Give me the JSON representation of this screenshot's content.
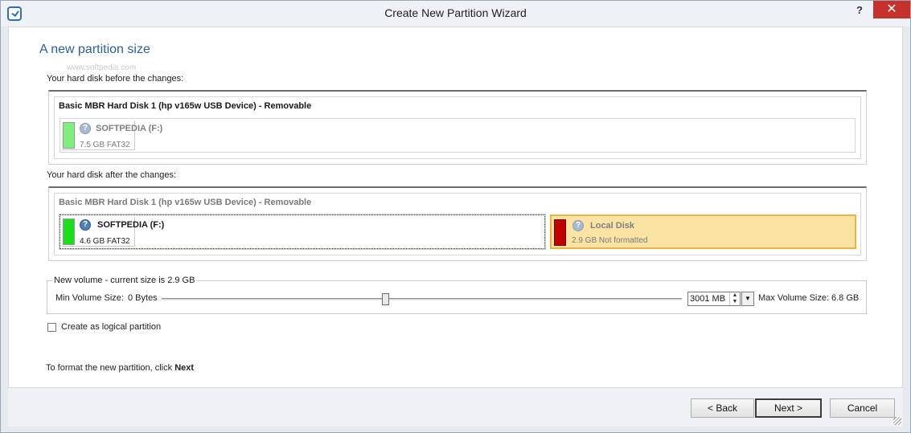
{
  "window": {
    "title": "Create New Partition Wizard",
    "help": "?",
    "close": "✕"
  },
  "page": {
    "heading": "A new partition size",
    "watermark": "www.softpedia.com",
    "before_label": "Your hard disk before the changes:",
    "after_label": "Your hard disk after the changes:"
  },
  "before": {
    "disk_title": "Basic MBR Hard Disk 1 (hp v165w USB Device) - Removable",
    "partitions": [
      {
        "name": "SOFTPEDIA (F:)",
        "info": "7.5 GB FAT32",
        "icon": "question-icon"
      }
    ]
  },
  "after": {
    "disk_title": "Basic MBR Hard Disk 1 (hp v165w USB Device) - Removable",
    "partitions": [
      {
        "name": "SOFTPEDIA (F:)",
        "info": "4.6 GB FAT32",
        "icon": "question-icon"
      },
      {
        "name": "Local Disk",
        "info": "2.9 GB Not formatted",
        "icon": "question-icon"
      }
    ]
  },
  "volume": {
    "legend": "New volume - current size is 2.9 GB",
    "min_label": "Min Volume Size:",
    "min_value": "0 Bytes",
    "spin_value": "3001 MB",
    "max_label": "Max Volume Size:",
    "max_value": "6.8 GB",
    "slider_fraction": 0.43
  },
  "options": {
    "logical_label": "Create as logical partition",
    "logical_checked": false
  },
  "hint": {
    "text": "To format the new partition, click ",
    "bold": "Next"
  },
  "buttons": {
    "back": "< Back",
    "next": "Next >",
    "cancel": "Cancel"
  },
  "colors": {
    "heading": "#2a5fa0",
    "fat32_bar": "#19e01a",
    "unformatted_bar": "#c10000",
    "unallocated_fill": "#fbe3a4",
    "close_button": "#c7312b"
  }
}
